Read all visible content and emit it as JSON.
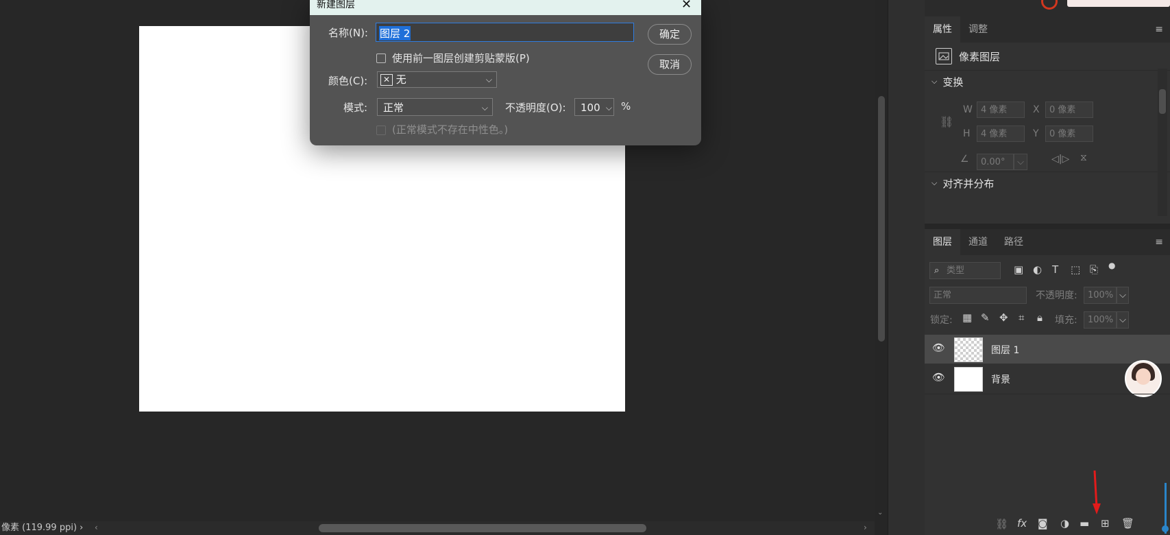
{
  "status_bar": {
    "text": "像素 (119.99 ppi)"
  },
  "dialog": {
    "title": "新建图层",
    "name_label": "名称(N):",
    "name_value": "图层 2",
    "clip_label": "使用前一图层创建剪贴蒙版(P)",
    "color_label": "颜色(C):",
    "color_value": "无",
    "mode_label": "模式:",
    "mode_value": "正常",
    "opacity_label": "不透明度(O):",
    "opacity_value": "100",
    "percent": "%",
    "neutral_label": "(正常模式不存在中性色。)",
    "ok": "确定",
    "cancel": "取消"
  },
  "properties": {
    "tabs": [
      "属性",
      "调整"
    ],
    "layer_type": "像素图层",
    "transform_title": "变换",
    "w_label": "W",
    "w_value": "4 像素",
    "x_label": "X",
    "x_value": "0 像素",
    "h_label": "H",
    "h_value": "4 像素",
    "y_label": "Y",
    "y_value": "0 像素",
    "angle_value": "0.00°",
    "align_title": "对齐并分布"
  },
  "layers_panel": {
    "tabs": [
      "图层",
      "通道",
      "路径"
    ],
    "filter_placeholder": "类型",
    "blend_mode": "正常",
    "opacity_label": "不透明度:",
    "opacity_value": "100%",
    "lock_label": "锁定:",
    "fill_label": "填充:",
    "fill_value": "100%",
    "layers": [
      {
        "name": "图层 1"
      },
      {
        "name": "背景"
      }
    ]
  },
  "colors": {
    "accent": "#1e6fd9",
    "annotation": "#e21b1b"
  }
}
